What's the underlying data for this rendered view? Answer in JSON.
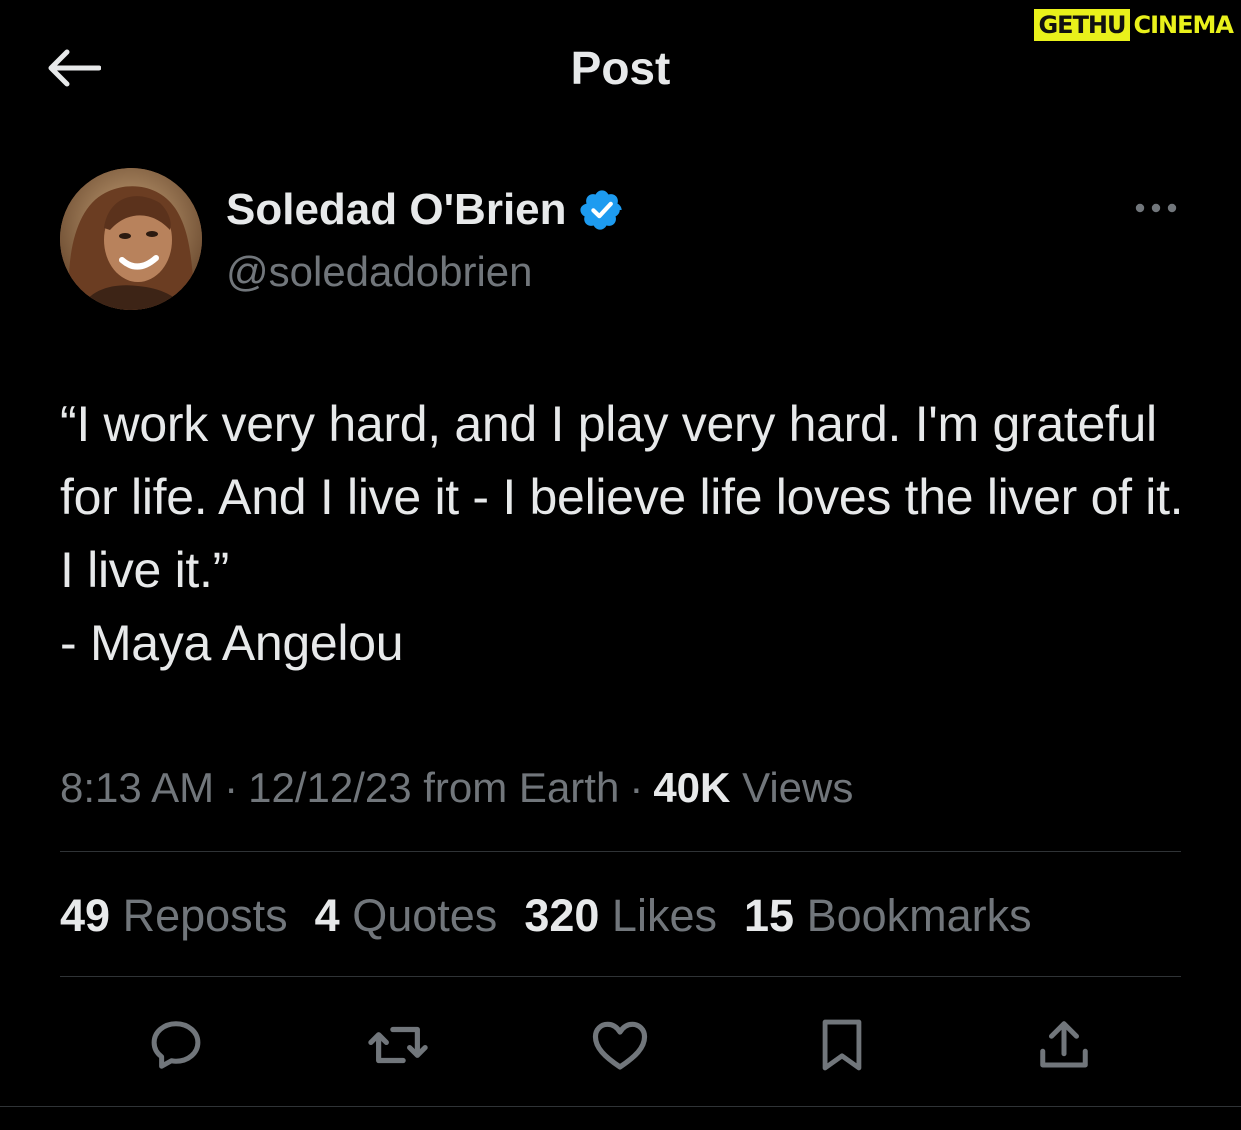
{
  "header": {
    "title": "Post",
    "back_icon": "arrow-left-icon"
  },
  "watermark": {
    "part1": "GETHU",
    "part2": "CINEMA",
    "color": "#e9f11b"
  },
  "author": {
    "display_name": "Soledad O'Brien",
    "handle": "@soledadobrien",
    "verified_icon": "verified-badge-icon",
    "verified_color": "#1d9bf0",
    "more_icon": "more-horizontal-icon"
  },
  "post": {
    "text": "“I work very hard, and I play very hard. I'm grateful for life. And I live it - I believe life loves the liver of it. I live it.”\n- Maya Angelou"
  },
  "meta": {
    "time": "8:13 AM",
    "separator": "·",
    "date_source": "12/12/23 from Earth",
    "views_count": "40K",
    "views_label": "Views"
  },
  "stats": [
    {
      "count": "49",
      "label": "Reposts"
    },
    {
      "count": "4",
      "label": "Quotes"
    },
    {
      "count": "320",
      "label": "Likes"
    },
    {
      "count": "15",
      "label": "Bookmarks"
    }
  ],
  "actions": [
    {
      "name": "reply",
      "icon": "reply-bubble-icon"
    },
    {
      "name": "repost",
      "icon": "repost-arrows-icon"
    },
    {
      "name": "like",
      "icon": "heart-icon"
    },
    {
      "name": "bookmark",
      "icon": "bookmark-icon"
    },
    {
      "name": "share",
      "icon": "share-upload-icon"
    }
  ],
  "colors": {
    "background": "#000000",
    "primary_text": "#e7e9ea",
    "secondary_text": "#71767b",
    "divider": "#2f3336"
  }
}
